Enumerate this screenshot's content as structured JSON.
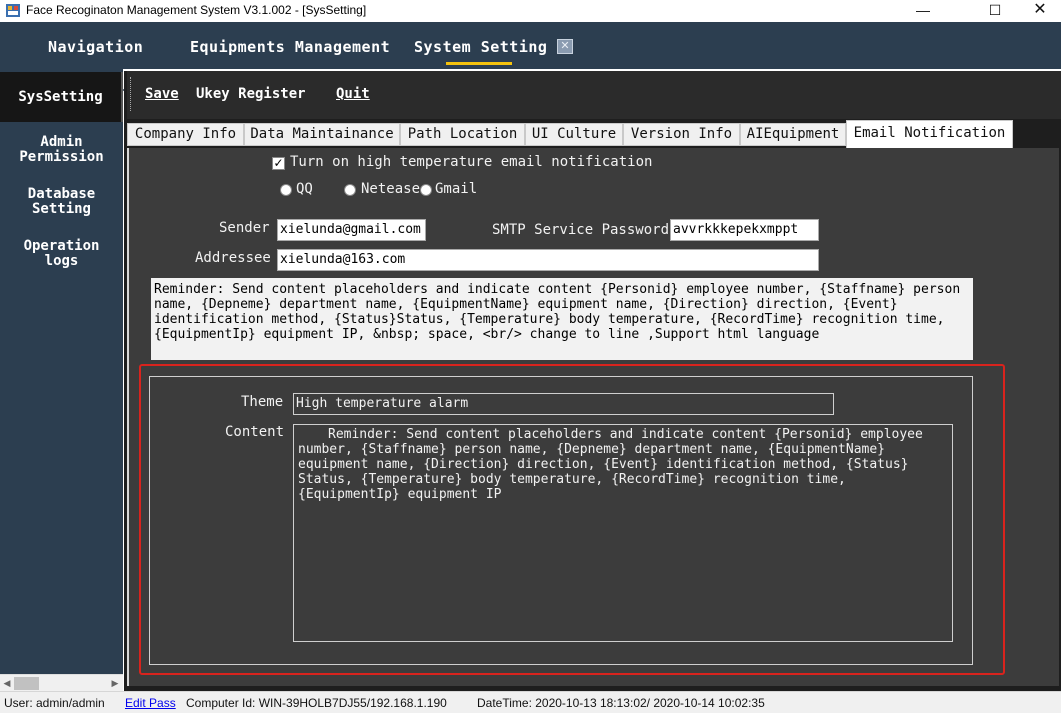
{
  "window": {
    "title": "Face Recoginaton Management System V3.1.002 - [SysSetting]",
    "min_glyph": "—",
    "max_glyph": "☐",
    "close_glyph": "✕"
  },
  "nav": {
    "tabs": [
      "Navigation",
      "Equipments Management",
      "System Setting"
    ],
    "active": "System Setting",
    "close_glyph": "✕"
  },
  "sidebar": {
    "items": [
      {
        "line1": "SysSetting",
        "line2": ""
      },
      {
        "line1": "Admin",
        "line2": "Permission"
      },
      {
        "line1": "Database",
        "line2": "Setting"
      },
      {
        "line1": "Operation",
        "line2": "logs"
      }
    ]
  },
  "toolbar": {
    "save": "Save",
    "ukey": "Ukey Register",
    "quit": "Quit"
  },
  "tabs": [
    "Company Info",
    "Data Maintainance",
    "Path Location",
    "UI Culture",
    "Version Info",
    "AIEquipment",
    "Email Notification"
  ],
  "email": {
    "enable_label": "Turn on high temperature email notification",
    "enable_checked": true,
    "check_glyph": "✓",
    "providers": [
      {
        "label": "QQ",
        "checked": false
      },
      {
        "label": "Netease",
        "checked": false
      },
      {
        "label": "Gmail",
        "checked": false
      }
    ],
    "sender_label": "Sender",
    "sender_value": "xielunda@gmail.com",
    "smtp_label": "SMTP Service Password",
    "smtp_value": "avvrkkkepekxmppt",
    "addressee_label": "Addressee",
    "addressee_value": "xielunda@163.com",
    "reminder": "Reminder: Send content placeholders and indicate content {Personid} employee number, {Staffname} person name, {Depneme} department name, {EquipmentName} equipment name, {Direction} direction, {Event} identification method, {Status}Status, {Temperature} body temperature, {RecordTime} recognition time, {EquipmentIp} equipment IP, &nbsp; space, <br/> change to line ,Support html language",
    "theme_label": "Theme",
    "theme_value": "High temperature alarm",
    "content_label": "Content",
    "content_value": "Reminder: Send content placeholders and indicate content {Personid} employee number, {Staffname} person name, {Depneme} department name, {EquipmentName} equipment name, {Direction} direction, {Event} identification method, {Status} Status, {Temperature} body temperature, {RecordTime} recognition time, {EquipmentIp} equipment IP"
  },
  "status": {
    "user": "User: admin/admin",
    "edit_pass": "Edit Pass",
    "computer": "Computer Id:  WIN-39HOLB7DJ55/192.168.1.190",
    "datetime": "DateTime:  2020-10-13 18:13:02/  2020-10-14 10:02:35"
  },
  "colors": {
    "nav_bg": "#2c3e50",
    "active_underline": "#f4c20d",
    "panel_bg": "#3c3c3c",
    "highlight_border": "#d9231d",
    "link": "#0000ee"
  }
}
